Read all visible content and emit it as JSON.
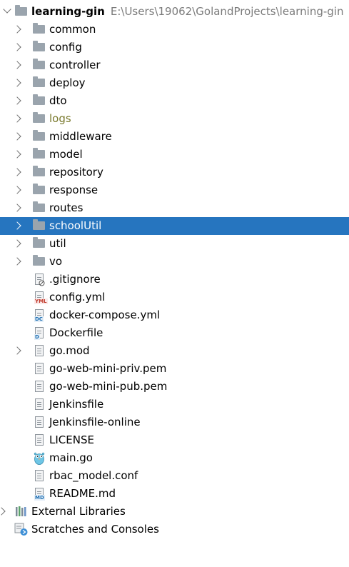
{
  "project": {
    "name": "learning-gin",
    "path": "E:\\Users\\19062\\GolandProjects\\learning-gin"
  },
  "folders": [
    {
      "label": "common"
    },
    {
      "label": "config"
    },
    {
      "label": "controller"
    },
    {
      "label": "deploy"
    },
    {
      "label": "dto"
    },
    {
      "label": "logs"
    },
    {
      "label": "middleware"
    },
    {
      "label": "model"
    },
    {
      "label": "repository"
    },
    {
      "label": "response"
    },
    {
      "label": "routes"
    },
    {
      "label": "schoolUtil"
    },
    {
      "label": "util"
    },
    {
      "label": "vo"
    }
  ],
  "files": [
    {
      "label": ".gitignore",
      "icon": "gitignore-file-icon"
    },
    {
      "label": "config.yml",
      "icon": "yaml-file-icon",
      "badge": "YML"
    },
    {
      "label": "docker-compose.yml",
      "icon": "docker-compose-file-icon",
      "badge": "DC"
    },
    {
      "label": "Dockerfile",
      "icon": "dockerfile-icon",
      "badge": "D"
    },
    {
      "label": "go.mod",
      "icon": "go-mod-file-icon"
    },
    {
      "label": "go-web-mini-priv.pem",
      "icon": "text-file-icon"
    },
    {
      "label": "go-web-mini-pub.pem",
      "icon": "text-file-icon"
    },
    {
      "label": "Jenkinsfile",
      "icon": "text-file-icon"
    },
    {
      "label": "Jenkinsfile-online",
      "icon": "text-file-icon"
    },
    {
      "label": "LICENSE",
      "icon": "text-file-icon"
    },
    {
      "label": "main.go",
      "icon": "go-gopher-icon"
    },
    {
      "label": "rbac_model.conf",
      "icon": "text-file-icon"
    },
    {
      "label": "README.md",
      "icon": "markdown-file-icon",
      "badge": "MD"
    }
  ],
  "external_libraries": {
    "label": "External Libraries"
  },
  "scratches": {
    "label": "Scratches and Consoles"
  },
  "selected": "schoolUtil",
  "colors": {
    "selection": "#2675bf",
    "folder": "#9aa4ad",
    "excluded_folder_text": "#7a7a2e",
    "path_text": "#7b7b7b"
  }
}
